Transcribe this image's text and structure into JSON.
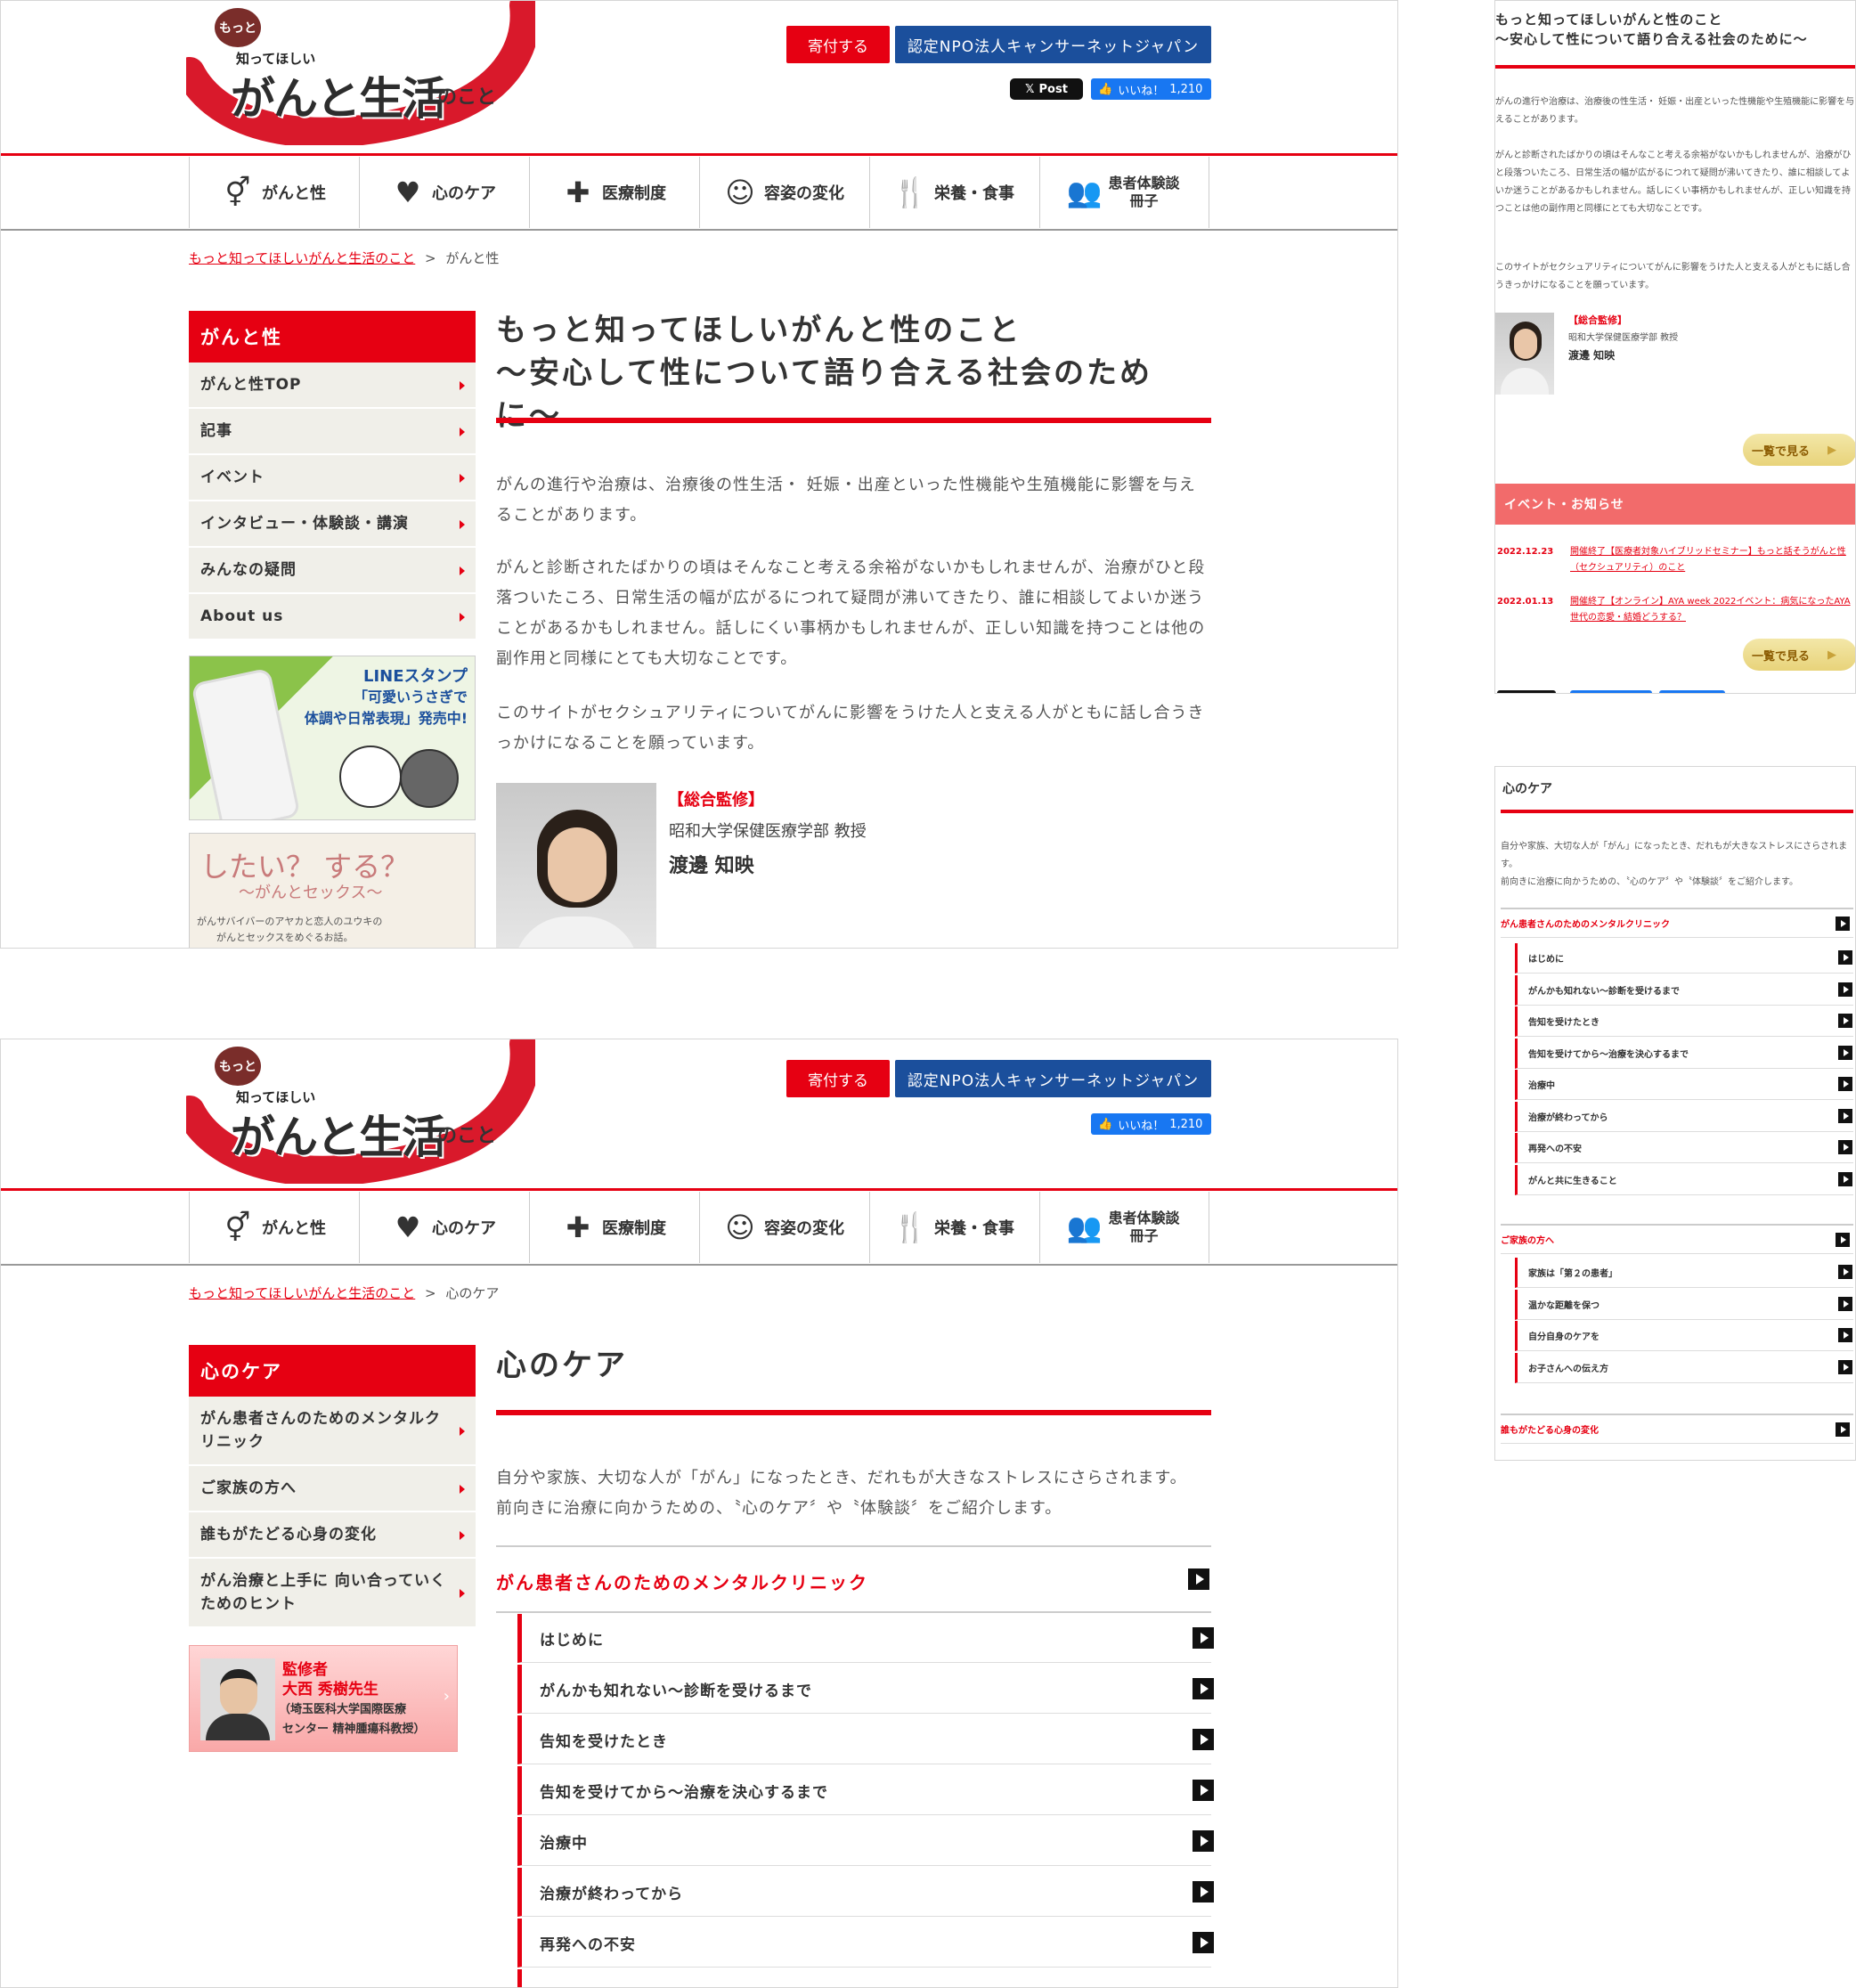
{
  "logo": {
    "bubble": "もっと",
    "sub": "知ってほしい",
    "main": "がんと生活",
    "tail": "のこと"
  },
  "header": {
    "donate": "寄付する",
    "npo": "認定NPO法人キャンサーネットジャパン",
    "x_post": "Post",
    "fb_like": "いいね！",
    "fb_count": "1,210"
  },
  "nav": [
    {
      "label": "がんと性",
      "icon": "gender-icon"
    },
    {
      "label": "心のケア",
      "icon": "heart-icon"
    },
    {
      "label": "医療制度",
      "icon": "medical-bag-icon"
    },
    {
      "label": "容姿の変化",
      "icon": "face-icon"
    },
    {
      "label": "栄養・食事",
      "icon": "cutlery-icon"
    },
    {
      "label": "患者体験談冊子",
      "line1": "患者体験談",
      "line2": "冊子",
      "icon": "people-icon"
    }
  ],
  "page1": {
    "breadcrumb_home": "もっと知ってほしいがんと生活のこと",
    "breadcrumb_sep": ">",
    "breadcrumb_current": "がんと性",
    "side_head": "がんと性",
    "side_items": [
      "がんと性TOP",
      "記事",
      "イベント",
      "インタビュー・体験談・講演",
      "みんなの疑問",
      "About us"
    ],
    "banner1_title": "LINEスタンプ",
    "banner1_l2": "「可愛いうさぎで",
    "banner1_l3": "体調や日常表現」発売中!",
    "banner2_title": "したい？ する？",
    "banner2_sub": "〜がんとセックス〜",
    "banner2_l1": "がんサバイバーのアヤカと恋人のユウキの",
    "banner2_l2": "がんとセックスをめぐるお話。",
    "title_l1": "もっと知ってほしいがんと性のこと",
    "title_l2": "〜安心して性について語り合える社会のために〜",
    "p1": "がんの進行や治療は、治療後の性生活・ 妊娠・出産といった性機能や生殖機能に影響を与えることがあります。",
    "p2": "がんと診断されたばかりの頃はそんなこと考える余裕がないかもしれませんが、治療がひと段落ついたころ、日常生活の幅が広がるにつれて疑問が沸いてきたり、誰に相談してよいか迷うことがあるかもしれません。話しにくい事柄かもしれませんが、正しい知識を持つことは他の副作用と同様にとても大切なことです。",
    "p3": "このサイトがセクシュアリティについてがんに影響をうけた人と支える人がともに話し合うきっかけになることを願っています。",
    "sup_label": "【総合監修】",
    "sup_aff": "昭和大学保健医療学部 教授",
    "sup_name": "渡邊 知映"
  },
  "page2": {
    "breadcrumb_home": "もっと知ってほしいがんと生活のこと",
    "breadcrumb_sep": ">",
    "breadcrumb_current": "心のケア",
    "side_head": "心のケア",
    "side_items": [
      "がん患者さんのためのメンタルクリニック",
      "ご家族の方へ",
      "誰もがたどる心身の変化",
      "がん治療と上手に 向い合っていくためのヒント"
    ],
    "sup_banner_l1": "監修者",
    "sup_banner_l2": "大西 秀樹先生",
    "sup_banner_l3": "（埼玉医科大学国際医療",
    "sup_banner_l4": "センター 精神腫瘍科教授）",
    "title": "心のケア",
    "p1": "自分や家族、大切な人が「がん」になったとき、だれもが大きなストレスにさらされます。",
    "p2": "前向きに治療に向かうための、〝心のケア〞や〝体験談〞をご紹介します。",
    "list_head": "がん患者さんのためのメンタルクリニック",
    "list_items": [
      "はじめに",
      "がんかも知れない〜診断を受けるまで",
      "告知を受けたとき",
      "告知を受けてから〜治療を決心するまで",
      "治療中",
      "治療が終わってから",
      "再発への不安"
    ]
  },
  "mobile1": {
    "title_l1": "もっと知ってほしいがんと性のこと",
    "title_l2": "〜安心して性について語り合える社会のために〜",
    "p1": "がんの進行や治療は、治療後の性生活・ 妊娠・出産といった性機能や生殖機能に影響を与えることがあります。",
    "p2": "がんと診断されたばかりの頃はそんなこと考える余裕がないかもしれませんが、治療がひと段落ついたころ、日常生活の幅が広がるにつれて疑問が沸いてきたり、誰に相談してよいか迷うことがあるかもしれません。話しにくい事柄かもしれませんが、正しい知識を持つことは他の副作用と同様にとても大切なことです。",
    "p3": "このサイトがセクシュアリティについてがんに影響をうけた人と支える人がともに話し合うきっかけになることを願っています。",
    "sup_label": "【総合監修】",
    "sup_aff": "昭和大学保健医療学部 教授",
    "sup_name": "渡邊 知映",
    "more1": "一覧で見る",
    "events_head": "イベント・お知らせ",
    "events": [
      {
        "date": "2022.12.23",
        "text": "開催終了【医療者対象ハイブリッドセミナー】もっと話そうがんと性（セクシュアリティ）のこと"
      },
      {
        "date": "2022.01.13",
        "text": "開催終了【オンライン】AYA week 2022イベント：病気になったAYA世代の恋愛・結婚どうする？"
      }
    ],
    "more2": "一覧で見る"
  },
  "mobile2": {
    "title": "心のケア",
    "p1": "自分や家族、大切な人が「がん」になったとき、だれもが大きなストレスにさらされます。",
    "p2": "前向きに治療に向かうための、〝心のケア〞や〝体験談〞をご紹介します。",
    "sec1": "がん患者さんのためのメンタルクリニック",
    "sec1_items": [
      "はじめに",
      "がんかも知れない〜診断を受けるまで",
      "告知を受けたとき",
      "告知を受けてから〜治療を決心するまで",
      "治療中",
      "治療が終わってから",
      "再発への不安",
      "がんと共に生きること"
    ],
    "sec2": "ご家族の方へ",
    "sec2_items": [
      "家族は「第２の患者」",
      "温かな距離を保つ",
      "自分自身のケアを",
      "お子さんへの伝え方"
    ],
    "sec3": "誰もがたどる心身の変化"
  },
  "colors": {
    "accent": "#e60012",
    "navy": "#1b4f9c",
    "side_bg": "#f0efe9"
  }
}
